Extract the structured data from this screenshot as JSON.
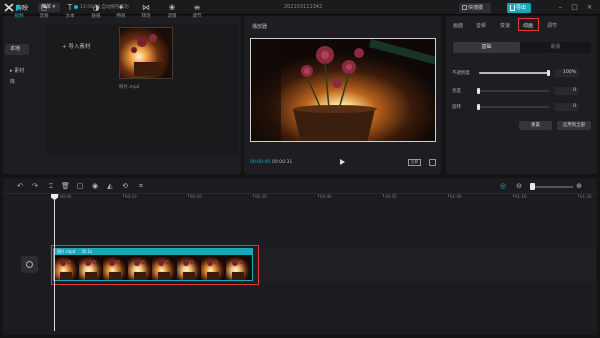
{
  "titlebar": {
    "app_name": "剪映",
    "menu_label": "菜单",
    "save_status": "13:56:20 自动保存成功",
    "project_title": "202103111342",
    "shortcut_label": "快捷键",
    "export_label": "导出"
  },
  "media": {
    "tools": [
      {
        "label": "视频",
        "glyph": "▶",
        "icon": "video-icon"
      },
      {
        "label": "音频",
        "glyph": "◔",
        "icon": "audio-icon"
      },
      {
        "label": "文本",
        "glyph": "T",
        "icon": "text-icon"
      },
      {
        "label": "贴纸",
        "glyph": "◑",
        "icon": "sticker-icon"
      },
      {
        "label": "特效",
        "glyph": "✦",
        "icon": "effect-icon"
      },
      {
        "label": "转场",
        "glyph": "⋈",
        "icon": "transition-icon"
      },
      {
        "label": "滤镜",
        "glyph": "❀",
        "icon": "filter-icon"
      },
      {
        "label": "调节",
        "glyph": "≡",
        "icon": "adjust-icon"
      }
    ],
    "side": [
      "本地",
      "素材库"
    ],
    "import_label": "导入素材",
    "thumb_name": "照片.mp4"
  },
  "player": {
    "title": "播放器",
    "current_time": "00:00:00",
    "total_time": "00:00:31",
    "ratio_label": "比例"
  },
  "inspector": {
    "tabs": [
      "画面",
      "音频",
      "变速",
      "动画",
      "调节"
    ],
    "active_tab": "动画",
    "subtabs": [
      "基础",
      "蒙版"
    ],
    "params": [
      {
        "label": "不透明度",
        "value": "100%",
        "level": 1.0
      },
      {
        "label": "亮度",
        "value": "0",
        "level": 0.0
      },
      {
        "label": "旋转",
        "value": "0",
        "level": 0.0
      }
    ],
    "reset_label": "重置",
    "apply_all_label": "应用到全部"
  },
  "timeline": {
    "ticks": [
      "00:00",
      "00:10",
      "00:20",
      "00:30",
      "00:40",
      "00:50",
      "01:00",
      "01:10",
      "01:20"
    ],
    "clip_name": "照片.mp4",
    "clip_duration": "30.1s"
  },
  "colors": {
    "accent": "#1fb0c8",
    "highlight": "#e03c3c"
  }
}
